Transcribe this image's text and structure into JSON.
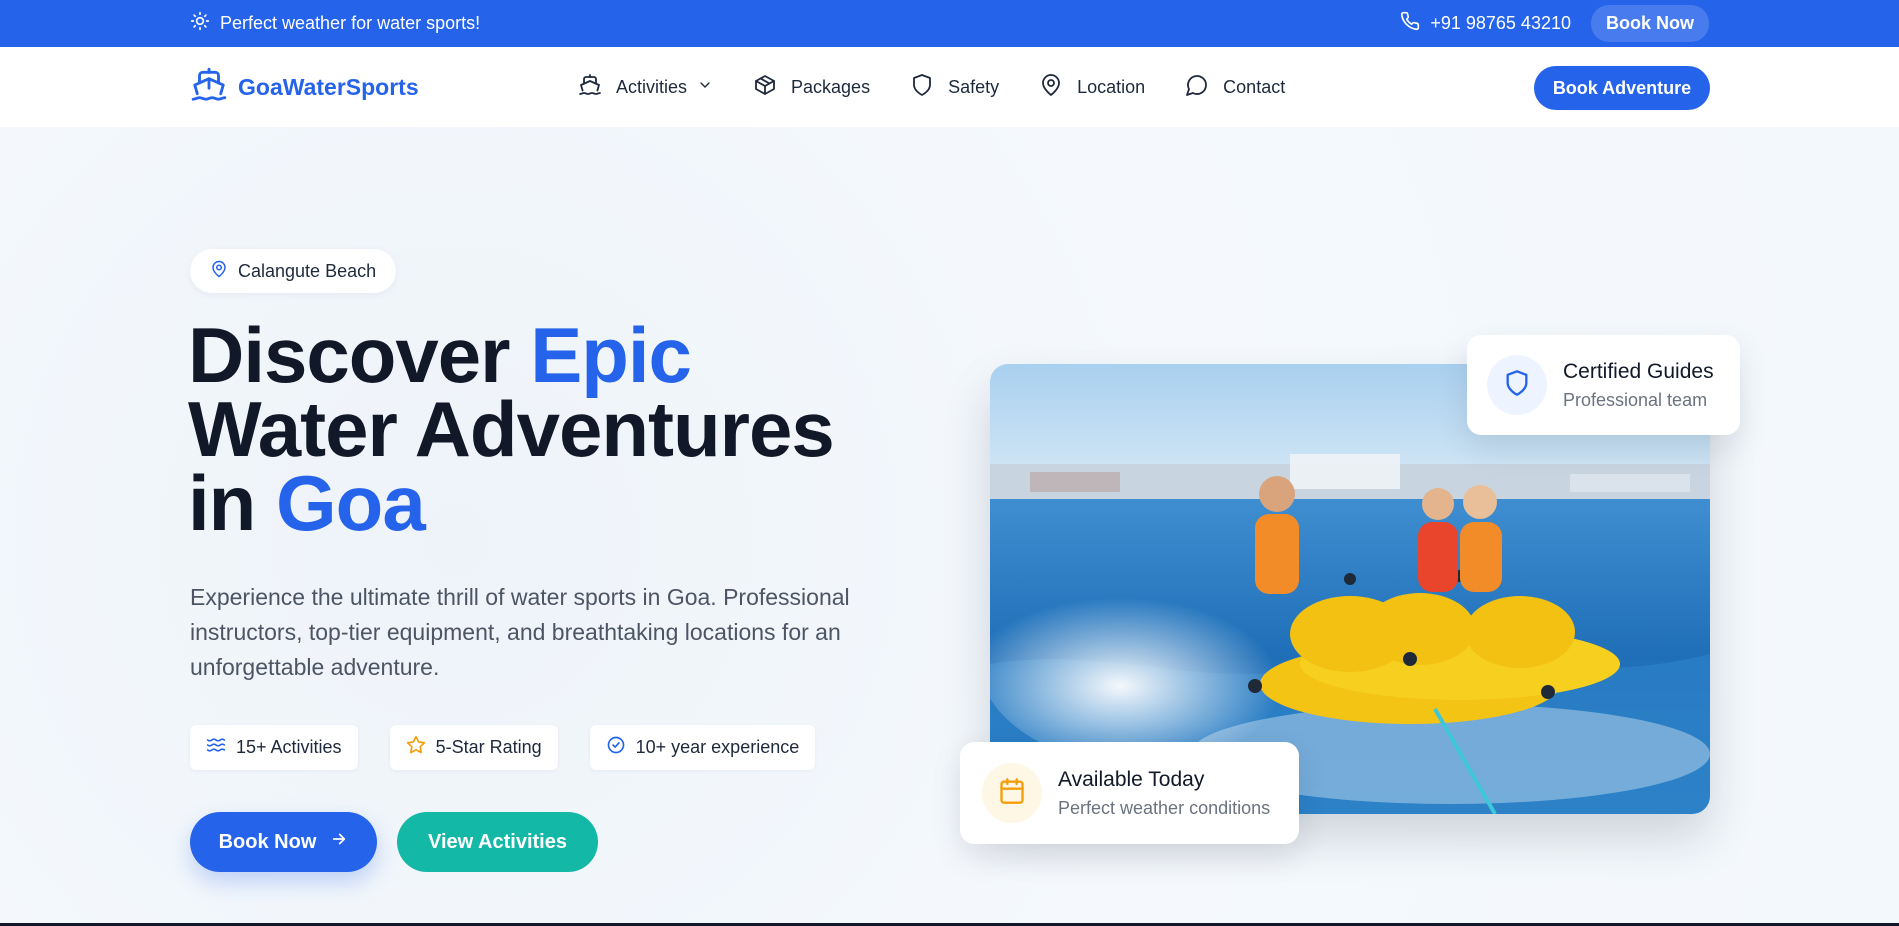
{
  "topbar": {
    "weather_text": "Perfect weather for water sports!",
    "phone": "+91 98765 43210",
    "book_label": "Book Now"
  },
  "nav": {
    "brand": "GoaWaterSports",
    "items": [
      {
        "label": "Activities",
        "icon": "boat-icon",
        "has_dropdown": true
      },
      {
        "label": "Packages",
        "icon": "package-icon"
      },
      {
        "label": "Safety",
        "icon": "shield-icon"
      },
      {
        "label": "Location",
        "icon": "map-pin-icon"
      },
      {
        "label": "Contact",
        "icon": "chat-icon"
      }
    ],
    "cta_label": "Book Adventure"
  },
  "hero": {
    "location_badge": "Calangute Beach",
    "headline": {
      "line1_a": "Discover",
      "line1_b": "Epic",
      "line2": "Water Adventures",
      "line3_a": "in",
      "line3_b": "Goa"
    },
    "description": "Experience the ultimate thrill of water sports in Goa. Professional instructors, top-tier equipment, and breathtaking locations for an unforgettable adventure.",
    "stats": [
      {
        "label": "15+ Activities",
        "icon": "waves-icon"
      },
      {
        "label": "5-Star Rating",
        "icon": "star-icon"
      },
      {
        "label": "10+ year experience",
        "icon": "check-badge-icon"
      }
    ],
    "primary_button": "Book Now",
    "secondary_button": "View Activities",
    "image_icon": "banana-boat-photo"
  },
  "cards": {
    "guides": {
      "title": "Certified Guides",
      "subtitle": "Professional team",
      "icon": "shield-icon"
    },
    "available": {
      "title": "Available Today",
      "subtitle": "Perfect weather conditions",
      "icon": "calendar-icon"
    }
  },
  "colors": {
    "primary": "#2563eb",
    "teal": "#14b8a6",
    "text_dark": "#111827",
    "star": "#f59e0b"
  }
}
